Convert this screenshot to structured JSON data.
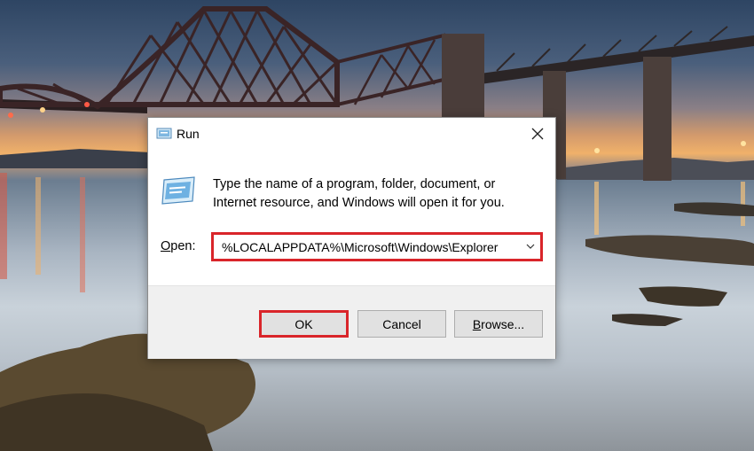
{
  "dialog": {
    "title": "Run",
    "description": "Type the name of a program, folder, document, or Internet resource, and Windows will open it for you.",
    "open_label_u": "O",
    "open_label_rest": "pen:",
    "open_value": "%LOCALAPPDATA%\\Microsoft\\Windows\\Explorer",
    "highlight_color": "#d9252a"
  },
  "buttons": {
    "ok_label": "OK",
    "cancel_label": "Cancel",
    "browse_u": "B",
    "browse_rest": "rowse..."
  },
  "icons": {
    "title": "run-app-icon",
    "big": "run-app-icon",
    "close": "close-icon",
    "dropdown": "chevron-down-icon"
  }
}
